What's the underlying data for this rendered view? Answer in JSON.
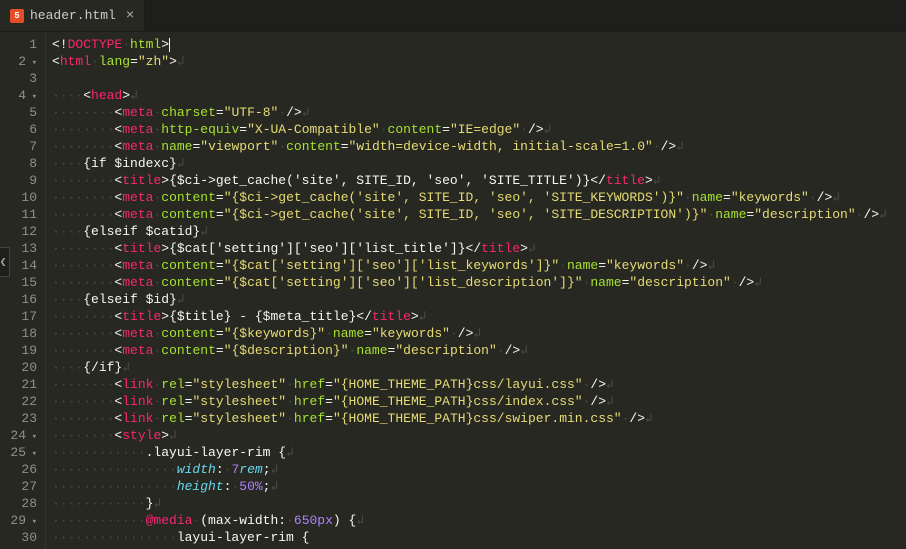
{
  "tab": {
    "title": "header.html",
    "close": "×"
  },
  "lines": [
    {
      "n": 1,
      "s": [
        [
          "pun",
          "<!"
        ],
        [
          "tag",
          "DOCTYPE"
        ],
        [
          "ws",
          "·"
        ],
        [
          "attr",
          "html"
        ],
        [
          "pun",
          ">"
        ],
        [
          "cursor",
          ""
        ]
      ]
    },
    {
      "n": 2,
      "fold": "▾",
      "s": [
        [
          "pun",
          "<"
        ],
        [
          "tag",
          "html"
        ],
        [
          "ws",
          "·"
        ],
        [
          "attr",
          "lang"
        ],
        [
          "pun",
          "="
        ],
        [
          "str",
          "\"zh\""
        ],
        [
          "pun",
          ">"
        ],
        [
          "ws",
          "↲"
        ]
      ]
    },
    {
      "n": 3,
      "s": []
    },
    {
      "n": 4,
      "fold": "▾",
      "s": [
        [
          "ws",
          "····"
        ],
        [
          "pun",
          "<"
        ],
        [
          "tag",
          "head"
        ],
        [
          "pun",
          ">"
        ],
        [
          "ws",
          "↲"
        ]
      ]
    },
    {
      "n": 5,
      "s": [
        [
          "ws",
          "········"
        ],
        [
          "pun",
          "<"
        ],
        [
          "tag",
          "meta"
        ],
        [
          "ws",
          "·"
        ],
        [
          "attr",
          "charset"
        ],
        [
          "pun",
          "="
        ],
        [
          "str",
          "\"UTF-8\""
        ],
        [
          "ws",
          "·"
        ],
        [
          "pun",
          "/>"
        ],
        [
          "ws",
          "↲"
        ]
      ]
    },
    {
      "n": 6,
      "s": [
        [
          "ws",
          "········"
        ],
        [
          "pun",
          "<"
        ],
        [
          "tag",
          "meta"
        ],
        [
          "ws",
          "·"
        ],
        [
          "attr",
          "http-equiv"
        ],
        [
          "pun",
          "="
        ],
        [
          "str",
          "\"X-UA-Compatible\""
        ],
        [
          "ws",
          "·"
        ],
        [
          "attr",
          "content"
        ],
        [
          "pun",
          "="
        ],
        [
          "str",
          "\"IE=edge\""
        ],
        [
          "ws",
          "·"
        ],
        [
          "pun",
          "/>"
        ],
        [
          "ws",
          "↲"
        ]
      ]
    },
    {
      "n": 7,
      "s": [
        [
          "ws",
          "········"
        ],
        [
          "pun",
          "<"
        ],
        [
          "tag",
          "meta"
        ],
        [
          "ws",
          "·"
        ],
        [
          "attr",
          "name"
        ],
        [
          "pun",
          "="
        ],
        [
          "str",
          "\"viewport\""
        ],
        [
          "ws",
          "·"
        ],
        [
          "attr",
          "content"
        ],
        [
          "pun",
          "="
        ],
        [
          "str",
          "\"width=device-width, initial-scale=1.0\""
        ],
        [
          "ws",
          "·"
        ],
        [
          "pun",
          "/>"
        ],
        [
          "ws",
          "↲"
        ]
      ]
    },
    {
      "n": 8,
      "s": [
        [
          "ws",
          "····"
        ],
        [
          "txt",
          "{if $indexc}"
        ],
        [
          "ws",
          "↲"
        ]
      ]
    },
    {
      "n": 9,
      "s": [
        [
          "ws",
          "········"
        ],
        [
          "pun",
          "<"
        ],
        [
          "tag",
          "title"
        ],
        [
          "pun",
          ">"
        ],
        [
          "txt",
          "{$ci->get_cache('site', SITE_ID, 'seo', 'SITE_TITLE')}"
        ],
        [
          "pun",
          "</"
        ],
        [
          "tag",
          "title"
        ],
        [
          "pun",
          ">"
        ],
        [
          "ws",
          "↲"
        ]
      ]
    },
    {
      "n": 10,
      "s": [
        [
          "ws",
          "········"
        ],
        [
          "pun",
          "<"
        ],
        [
          "tag",
          "meta"
        ],
        [
          "ws",
          "·"
        ],
        [
          "attr",
          "content"
        ],
        [
          "pun",
          "="
        ],
        [
          "str",
          "\"{$ci->get_cache('site', SITE_ID, 'seo', 'SITE_KEYWORDS')}\""
        ],
        [
          "ws",
          "·"
        ],
        [
          "attr",
          "name"
        ],
        [
          "pun",
          "="
        ],
        [
          "str",
          "\"keywords\""
        ],
        [
          "ws",
          "·"
        ],
        [
          "pun",
          "/>"
        ],
        [
          "ws",
          "↲"
        ]
      ]
    },
    {
      "n": 11,
      "s": [
        [
          "ws",
          "········"
        ],
        [
          "pun",
          "<"
        ],
        [
          "tag",
          "meta"
        ],
        [
          "ws",
          "·"
        ],
        [
          "attr",
          "content"
        ],
        [
          "pun",
          "="
        ],
        [
          "str",
          "\"{$ci->get_cache('site', SITE_ID, 'seo', 'SITE_DESCRIPTION')}\""
        ],
        [
          "ws",
          "·"
        ],
        [
          "attr",
          "name"
        ],
        [
          "pun",
          "="
        ],
        [
          "str",
          "\"description\""
        ],
        [
          "ws",
          "·"
        ],
        [
          "pun",
          "/>"
        ],
        [
          "ws",
          "↲"
        ]
      ]
    },
    {
      "n": 12,
      "s": [
        [
          "ws",
          "····"
        ],
        [
          "txt",
          "{elseif $catid}"
        ],
        [
          "ws",
          "↲"
        ]
      ]
    },
    {
      "n": 13,
      "s": [
        [
          "ws",
          "········"
        ],
        [
          "pun",
          "<"
        ],
        [
          "tag",
          "title"
        ],
        [
          "pun",
          ">"
        ],
        [
          "txt",
          "{$cat['setting']['seo']['list_title']}"
        ],
        [
          "pun",
          "</"
        ],
        [
          "tag",
          "title"
        ],
        [
          "pun",
          ">"
        ],
        [
          "ws",
          "↲"
        ]
      ]
    },
    {
      "n": 14,
      "s": [
        [
          "ws",
          "········"
        ],
        [
          "pun",
          "<"
        ],
        [
          "tag",
          "meta"
        ],
        [
          "ws",
          "·"
        ],
        [
          "attr",
          "content"
        ],
        [
          "pun",
          "="
        ],
        [
          "str",
          "\"{$cat['setting']['seo']['list_keywords']}\""
        ],
        [
          "ws",
          "·"
        ],
        [
          "attr",
          "name"
        ],
        [
          "pun",
          "="
        ],
        [
          "str",
          "\"keywords\""
        ],
        [
          "ws",
          "·"
        ],
        [
          "pun",
          "/>"
        ],
        [
          "ws",
          "↲"
        ]
      ]
    },
    {
      "n": 15,
      "s": [
        [
          "ws",
          "········"
        ],
        [
          "pun",
          "<"
        ],
        [
          "tag",
          "meta"
        ],
        [
          "ws",
          "·"
        ],
        [
          "attr",
          "content"
        ],
        [
          "pun",
          "="
        ],
        [
          "str",
          "\"{$cat['setting']['seo']['list_description']}\""
        ],
        [
          "ws",
          "·"
        ],
        [
          "attr",
          "name"
        ],
        [
          "pun",
          "="
        ],
        [
          "str",
          "\"description\""
        ],
        [
          "ws",
          "·"
        ],
        [
          "pun",
          "/>"
        ],
        [
          "ws",
          "↲"
        ]
      ]
    },
    {
      "n": 16,
      "s": [
        [
          "ws",
          "····"
        ],
        [
          "txt",
          "{elseif $id}"
        ],
        [
          "ws",
          "↲"
        ]
      ]
    },
    {
      "n": 17,
      "s": [
        [
          "ws",
          "········"
        ],
        [
          "pun",
          "<"
        ],
        [
          "tag",
          "title"
        ],
        [
          "pun",
          ">"
        ],
        [
          "txt",
          "{$title} - {$meta_title}"
        ],
        [
          "pun",
          "</"
        ],
        [
          "tag",
          "title"
        ],
        [
          "pun",
          ">"
        ],
        [
          "ws",
          "↲"
        ]
      ]
    },
    {
      "n": 18,
      "s": [
        [
          "ws",
          "········"
        ],
        [
          "pun",
          "<"
        ],
        [
          "tag",
          "meta"
        ],
        [
          "ws",
          "·"
        ],
        [
          "attr",
          "content"
        ],
        [
          "pun",
          "="
        ],
        [
          "str",
          "\"{$keywords}\""
        ],
        [
          "ws",
          "·"
        ],
        [
          "attr",
          "name"
        ],
        [
          "pun",
          "="
        ],
        [
          "str",
          "\"keywords\""
        ],
        [
          "ws",
          "·"
        ],
        [
          "pun",
          "/>"
        ],
        [
          "ws",
          "↲"
        ]
      ]
    },
    {
      "n": 19,
      "s": [
        [
          "ws",
          "········"
        ],
        [
          "pun",
          "<"
        ],
        [
          "tag",
          "meta"
        ],
        [
          "ws",
          "·"
        ],
        [
          "attr",
          "content"
        ],
        [
          "pun",
          "="
        ],
        [
          "str",
          "\"{$description}\""
        ],
        [
          "ws",
          "·"
        ],
        [
          "attr",
          "name"
        ],
        [
          "pun",
          "="
        ],
        [
          "str",
          "\"description\""
        ],
        [
          "ws",
          "·"
        ],
        [
          "pun",
          "/>"
        ],
        [
          "ws",
          "↲"
        ]
      ]
    },
    {
      "n": 20,
      "s": [
        [
          "ws",
          "····"
        ],
        [
          "txt",
          "{/if}"
        ],
        [
          "ws",
          "↲"
        ]
      ]
    },
    {
      "n": 21,
      "s": [
        [
          "ws",
          "········"
        ],
        [
          "pun",
          "<"
        ],
        [
          "tag",
          "link"
        ],
        [
          "ws",
          "·"
        ],
        [
          "attr",
          "rel"
        ],
        [
          "pun",
          "="
        ],
        [
          "str",
          "\"stylesheet\""
        ],
        [
          "ws",
          "·"
        ],
        [
          "attr",
          "href"
        ],
        [
          "pun",
          "="
        ],
        [
          "str",
          "\"{HOME_THEME_PATH}css/layui.css\""
        ],
        [
          "ws",
          "·"
        ],
        [
          "pun",
          "/>"
        ],
        [
          "ws",
          "↲"
        ]
      ]
    },
    {
      "n": 22,
      "s": [
        [
          "ws",
          "········"
        ],
        [
          "pun",
          "<"
        ],
        [
          "tag",
          "link"
        ],
        [
          "ws",
          "·"
        ],
        [
          "attr",
          "rel"
        ],
        [
          "pun",
          "="
        ],
        [
          "str",
          "\"stylesheet\""
        ],
        [
          "ws",
          "·"
        ],
        [
          "attr",
          "href"
        ],
        [
          "pun",
          "="
        ],
        [
          "str",
          "\"{HOME_THEME_PATH}css/index.css\""
        ],
        [
          "ws",
          "·"
        ],
        [
          "pun",
          "/>"
        ],
        [
          "ws",
          "↲"
        ]
      ]
    },
    {
      "n": 23,
      "s": [
        [
          "ws",
          "········"
        ],
        [
          "pun",
          "<"
        ],
        [
          "tag",
          "link"
        ],
        [
          "ws",
          "·"
        ],
        [
          "attr",
          "rel"
        ],
        [
          "pun",
          "="
        ],
        [
          "str",
          "\"stylesheet\""
        ],
        [
          "ws",
          "·"
        ],
        [
          "attr",
          "href"
        ],
        [
          "pun",
          "="
        ],
        [
          "str",
          "\"{HOME_THEME_PATH}css/swiper.min.css\""
        ],
        [
          "ws",
          "·"
        ],
        [
          "pun",
          "/>"
        ],
        [
          "ws",
          "↲"
        ]
      ]
    },
    {
      "n": 24,
      "fold": "▾",
      "s": [
        [
          "ws",
          "········"
        ],
        [
          "pun",
          "<"
        ],
        [
          "tag",
          "style"
        ],
        [
          "pun",
          ">"
        ],
        [
          "ws",
          "↲"
        ]
      ]
    },
    {
      "n": 25,
      "fold": "▾",
      "s": [
        [
          "ws",
          "············"
        ],
        [
          "txt",
          ".layui-layer-rim {"
        ],
        [
          "ws",
          "↲"
        ]
      ]
    },
    {
      "n": 26,
      "s": [
        [
          "ws",
          "················"
        ],
        [
          "kw",
          "width"
        ],
        [
          "txt",
          ":"
        ],
        [
          "ws",
          "·"
        ],
        [
          "num",
          "7"
        ],
        [
          "kw",
          "rem"
        ],
        [
          "txt",
          ";"
        ],
        [
          "ws",
          "↲"
        ]
      ]
    },
    {
      "n": 27,
      "s": [
        [
          "ws",
          "················"
        ],
        [
          "kw",
          "height"
        ],
        [
          "txt",
          ":"
        ],
        [
          "ws",
          "·"
        ],
        [
          "num",
          "50%"
        ],
        [
          "txt",
          ";"
        ],
        [
          "ws",
          "↲"
        ]
      ]
    },
    {
      "n": 28,
      "s": [
        [
          "ws",
          "············"
        ],
        [
          "txt",
          "}"
        ],
        [
          "ws",
          "↲"
        ]
      ]
    },
    {
      "n": 29,
      "fold": "▾",
      "s": [
        [
          "ws",
          "············"
        ],
        [
          "tag",
          "@media"
        ],
        [
          "ws",
          "·"
        ],
        [
          "txt",
          "(max-width:"
        ],
        [
          "ws",
          "·"
        ],
        [
          "num",
          "650px"
        ],
        [
          "txt",
          ") {"
        ],
        [
          "ws",
          "↲"
        ]
      ]
    },
    {
      "n": 30,
      "s": [
        [
          "ws",
          "················"
        ],
        [
          "txt",
          "layui-layer-rim {"
        ]
      ]
    }
  ]
}
